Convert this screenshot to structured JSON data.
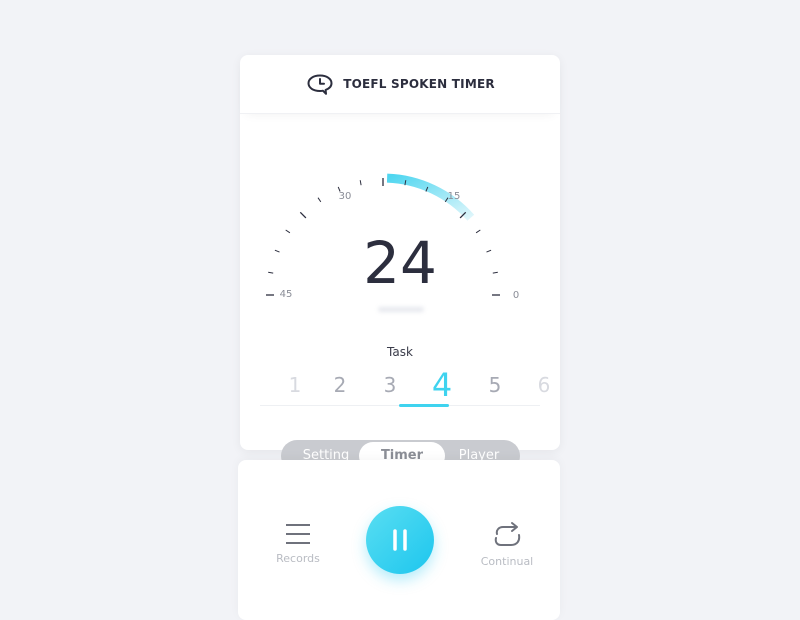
{
  "header": {
    "title": "TOEFL SPOKEN TIMER",
    "icon": "speech-bubble-clock-icon"
  },
  "timer": {
    "value": "24",
    "progress_fraction": 0.53,
    "scale_max": 45,
    "scale_labels": [
      "45",
      "30",
      "15",
      "0"
    ],
    "accent_color": "#3fd3ef"
  },
  "tasks": {
    "label": "Task",
    "items": [
      "1",
      "2",
      "3",
      "4",
      "5",
      "6"
    ],
    "selected": "4"
  },
  "mode_switch": {
    "items": [
      "Setting",
      "Timer",
      "Player"
    ],
    "selected": "Timer"
  },
  "controls": {
    "records_label": "Records",
    "continual_label": "Continual",
    "records_icon": "menu-icon",
    "pause_icon": "pause-icon",
    "continual_icon": "repeat-icon"
  }
}
